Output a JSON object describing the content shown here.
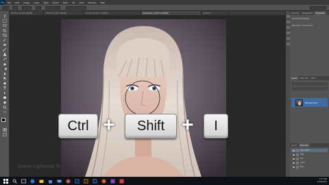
{
  "app": {
    "logo": "Ps"
  },
  "menubar": {
    "items": [
      "File",
      "Edit",
      "Image",
      "Layer",
      "Type",
      "Select",
      "Filter",
      "3D",
      "View",
      "Window",
      "Help"
    ]
  },
  "tabs": [
    {
      "label": "Untitled-1 @ 50% (RGB/8)"
    },
    {
      "label": "Untitled-2 @ 50% (RGB/8)"
    },
    {
      "label": "Untitled-3 @ 66.7% (RGB/8)"
    },
    {
      "label": "shutterstock_ @ 66.7% (RGB/8)",
      "active": true
    },
    {
      "label": "Untitled-4"
    }
  ],
  "keyboard_shortcut": {
    "keys": [
      "Ctrl",
      "Shift",
      "I"
    ],
    "separator": "+"
  },
  "watermark": "Online Lightroom Tr",
  "panels": {
    "top_tabs": [
      "Libraries",
      "Adjustments",
      "Properties"
    ],
    "properties_text": "Document Properties",
    "resolution_text": "Resolution: 72 pixels/inch",
    "layers_tabs": [
      "Layers",
      "Channels",
      "Paths"
    ],
    "layer_name": "Background",
    "channels_tabs": [
      "Layers",
      "Channels"
    ],
    "channels": [
      {
        "name": "Quick Mask",
        "active": true
      },
      {
        "name": "RGB"
      },
      {
        "name": "Red"
      },
      {
        "name": "Green"
      },
      {
        "name": "Blue"
      }
    ]
  },
  "taskbar": {
    "icons": [
      "windows-start-icon",
      "search-icon",
      "task-view-icon",
      "edge-icon",
      "folder-icon",
      "store-icon",
      "mail-icon",
      "chrome-icon",
      "photoshop-icon",
      "bridge-icon",
      "lightroom-icon",
      "media-icon",
      "app-icon",
      "app-icon"
    ],
    "time": "2:17 PM",
    "date": "3/16/2017"
  },
  "colors": {
    "menubar": "#3a3a3a",
    "panel": "#535353",
    "canvas": "#282828",
    "selected_layer": "#3f6ba6",
    "taskbar": "#0f1116"
  }
}
